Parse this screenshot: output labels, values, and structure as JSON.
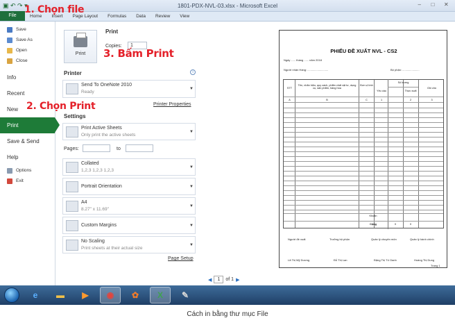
{
  "window": {
    "title": "1801-PDX-NVL-03.xlsx - Microsoft Excel",
    "controls": [
      "–",
      "□",
      "✕"
    ]
  },
  "ribbon": {
    "file_tab": "File",
    "tabs": [
      "Home",
      "Insert",
      "Page Layout",
      "Formulas",
      "Data",
      "Review",
      "View"
    ]
  },
  "nav": {
    "small_items": [
      {
        "label": "Save",
        "icon": "save-icon"
      },
      {
        "label": "Save As",
        "icon": "save-as-icon"
      },
      {
        "label": "Open",
        "icon": "folder-open-icon"
      },
      {
        "label": "Close",
        "icon": "close-file-icon"
      }
    ],
    "info": "Info",
    "recent": "Recent",
    "new": "New",
    "print": "Print",
    "save_send": "Save & Send",
    "help": "Help",
    "options": "Options",
    "exit": "Exit"
  },
  "print_panel": {
    "header": "Print",
    "copies_label": "Copies:",
    "copies_value": "1",
    "print_button": "Print",
    "printer_header": "Printer",
    "printer_name": "Send To OneNote 2010",
    "printer_status": "Ready",
    "printer_properties": "Printer Properties",
    "settings_header": "Settings",
    "settings": [
      {
        "title": "Print Active Sheets",
        "sub": "Only print the active sheets"
      },
      {
        "title": "Collated",
        "sub": "1,2,3    1,2,3    1,2,3"
      },
      {
        "title": "Portrait Orientation",
        "sub": ""
      },
      {
        "title": "A4",
        "sub": "8.27\" x 11.69\""
      },
      {
        "title": "Custom Margins",
        "sub": ""
      },
      {
        "title": "No Scaling",
        "sub": "Print sheets at their actual size"
      }
    ],
    "pages_label": "Pages:",
    "pages_to": "to",
    "page_setup": "Page Setup"
  },
  "preview": {
    "title": "PHIẾU ĐỀ XUẤT NVL - CS2",
    "date_line": "Ngày ...... tháng ...... năm 2018",
    "dept_label": "Bộ phận: ......................",
    "receiver": "Người nhận Hàng: ...........................",
    "headers": {
      "stt": "STT",
      "name": "Tên, nhãn hiệu, quy cách, phẩm chất vật tư, dụng cụ, sản phẩm, hàng hóa",
      "unit": "Đơn vị tính",
      "qty": "Số lượng",
      "req": "Yêu cầu",
      "actual": "Thực xuất",
      "note": "Ghi chú"
    },
    "index_row": [
      "A",
      "B",
      "C",
      "1",
      "2",
      "3"
    ],
    "khoan_label": "Khoản",
    "total_label": "Cộng",
    "total_values": [
      "0",
      "0"
    ],
    "signers_titles": [
      "Người đề xuất",
      "Trưởng bộ phận",
      "Quản lý chuyên môn",
      "Quản lý hành chính"
    ],
    "signers_names": [
      "Lã Thị Mỹ Dương",
      "Đỗ Thị Lan",
      "Đặng Thị Tố Oanh",
      "Hoàng Thị Dung"
    ],
    "page_label": "Trang 1",
    "pager_value": "1",
    "pager_total": "of 1"
  },
  "annotations": {
    "step1": "1. Chọn file",
    "step2": "2. Chọn Print",
    "step3": "3. Bấm Print"
  },
  "taskbar": {
    "items": [
      "start-orb",
      "ie-icon",
      "explorer-icon",
      "media-player-icon",
      "chrome-icon",
      "app-icon",
      "excel-icon",
      "paint-icon"
    ]
  },
  "caption": "Cách in bằng thư mục File"
}
